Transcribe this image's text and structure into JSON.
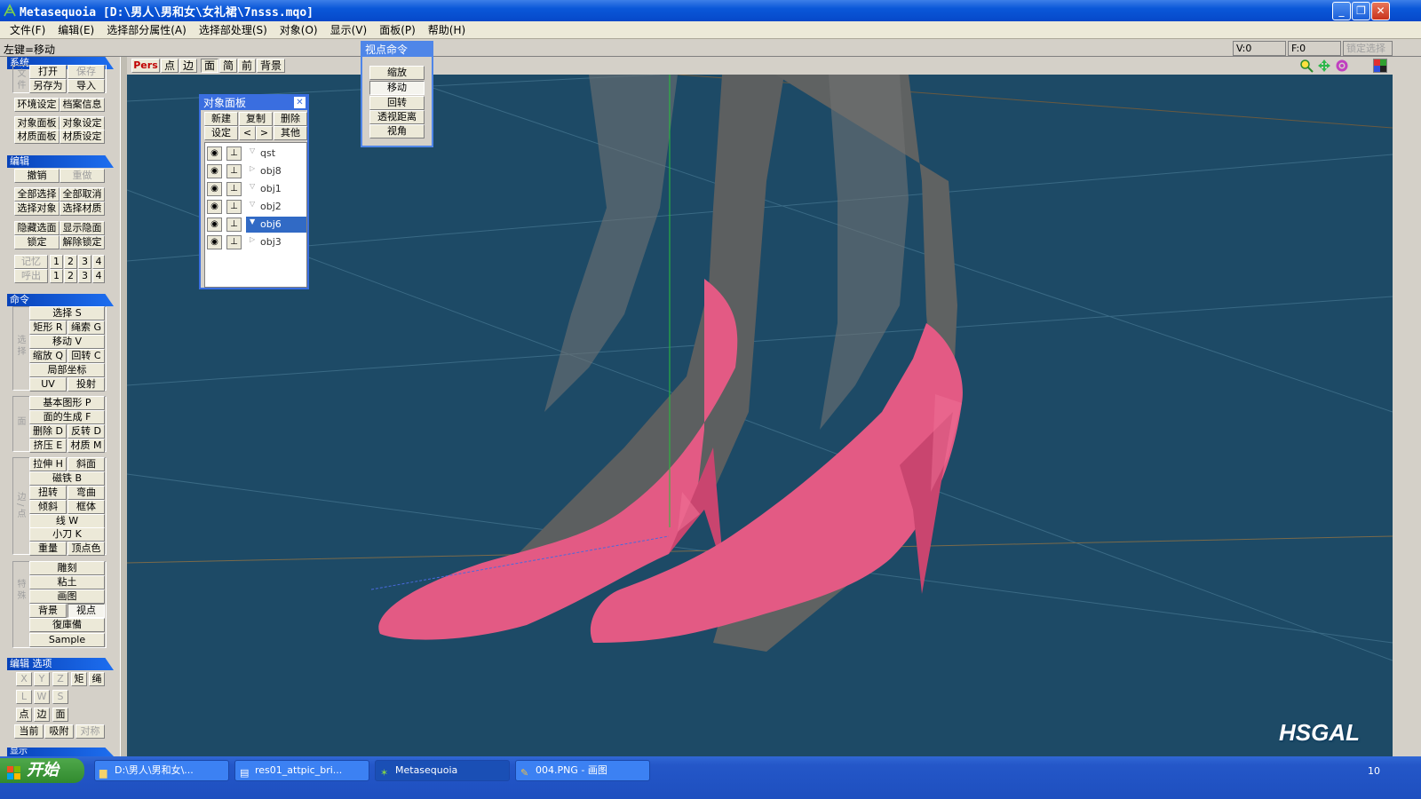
{
  "window": {
    "title": "Metasequoia [D:\\男人\\男和女\\女礼裙\\7nsss.mqo]"
  },
  "menu": [
    "文件(F)",
    "编辑(E)",
    "选择部分属性(A)",
    "选择部处理(S)",
    "对象(O)",
    "显示(V)",
    "面板(P)",
    "帮助(H)"
  ],
  "infobar": {
    "hint": "左键=移动",
    "v": "V:0",
    "f": "F:0",
    "lock": "锁定选择"
  },
  "left": {
    "system": {
      "header": "系统",
      "side_label": "文件",
      "row1": [
        "打开",
        "保存"
      ],
      "row2": [
        "另存为",
        "导入"
      ],
      "row3": [
        "环境设定",
        "档案信息"
      ],
      "row4": [
        "对象面板",
        "对象设定"
      ],
      "row5": [
        "材质面板",
        "材质设定"
      ]
    },
    "edit": {
      "header": "编辑",
      "undo": [
        "撤销",
        "重做"
      ],
      "sel1": [
        "全部选择",
        "全部取消"
      ],
      "sel2": [
        "选择对象",
        "选择材质"
      ],
      "hide": [
        "隐藏选面",
        "显示隐面"
      ],
      "lock": [
        "锁定",
        "解除锁定"
      ],
      "memory_label": "记忆",
      "recall_label": "呼出",
      "nums": [
        "1",
        "2",
        "3",
        "4"
      ]
    },
    "command": {
      "header": "命令",
      "side_select": "选择",
      "side_face": "面",
      "side_edge": "边/点",
      "side_misc": "特殊",
      "select": "选择 S",
      "rect": "矩形 R",
      "rope": "绳索 G",
      "move": "移动 V",
      "scale": "缩放 Q",
      "rotate": "回转 C",
      "local": "局部坐标",
      "uv": "UV",
      "project": "投射",
      "basic": "基本图形 P",
      "face_gen": "面的生成 F",
      "delete": "删除 D",
      "flip": "反转 D",
      "extrude": "挤压 E",
      "material": "材质 M",
      "stretch": "拉伸 H",
      "bevel": "斜面",
      "magnet": "磁铁 B",
      "twist": "扭转",
      "bend": "弯曲",
      "tilt": "倾斜",
      "lattice": "框体",
      "line": "线 W",
      "knife": "小刀 K",
      "overlap": "重量",
      "vcolor": "顶点色",
      "sculpt": "雕刻",
      "clay": "粘土",
      "paint": "画图",
      "bg": "背景",
      "viewpoint": "视点",
      "mirror": "復庫備",
      "sample": "Sample"
    },
    "editopt": {
      "header": "编辑 选项",
      "x": "X",
      "y": "Y",
      "z": "Z",
      "rect": "矩",
      "rope": "绳",
      "l": "L",
      "w": "W",
      "s": "S",
      "point": "点",
      "edge": "边",
      "face": "面",
      "current": "当前",
      "snap": "吸附",
      "sym": "对称"
    },
    "display": {
      "header": "显示"
    }
  },
  "viewtool": {
    "pers": "Pers",
    "point": "点",
    "edge": "边",
    "face": "面",
    "simple": "简",
    "front": "前",
    "bg": "背景"
  },
  "objpanel": {
    "title": "对象面板",
    "row1": [
      "新建",
      "复制",
      "删除"
    ],
    "row2": [
      "设定",
      "<",
      ">",
      "其他"
    ],
    "objects": [
      {
        "name": "qst",
        "expanded": true
      },
      {
        "name": "obj8",
        "expanded": false
      },
      {
        "name": "obj1",
        "expanded": true
      },
      {
        "name": "obj2",
        "expanded": true
      },
      {
        "name": "obj6",
        "expanded": true,
        "selected": true
      },
      {
        "name": "obj3",
        "expanded": false
      }
    ]
  },
  "vppanel": {
    "title": "视点命令",
    "buttons": [
      "缩放",
      "移动",
      "回转",
      "透视距离",
      "视角"
    ],
    "active": "移动"
  },
  "taskbar": {
    "start": "开始",
    "tasks": [
      "D:\\男人\\男和女\\...",
      "res01_attpic_bri...",
      "Metasequoia",
      "004.PNG - 画图"
    ],
    "clock": "10"
  },
  "watermark": "HSGAL",
  "colors": {
    "viewport": "#1d4a66",
    "shoe": "#e35a84",
    "selection": "#316ac5",
    "title": "#0a57d8"
  }
}
